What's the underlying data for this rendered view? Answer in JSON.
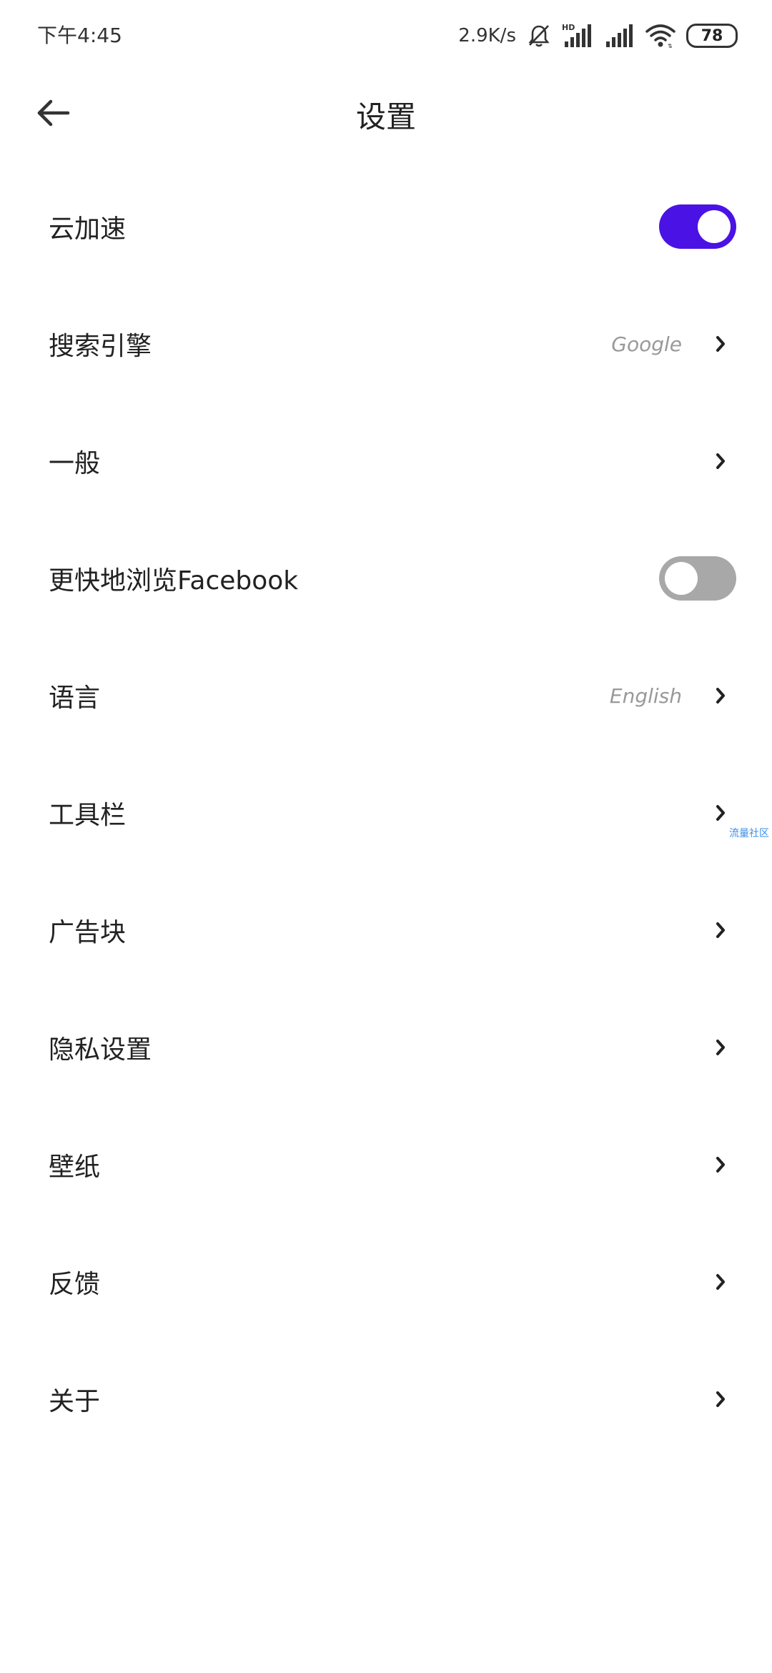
{
  "status_bar": {
    "time": "下午4:45",
    "net_speed": "2.9K/s",
    "battery": "78",
    "icons": [
      "mute-bell-icon",
      "hd-signal-icon",
      "signal-icon",
      "wifi-icon",
      "battery-icon"
    ]
  },
  "app_bar": {
    "title": "设置",
    "back_icon": "arrow-left-icon"
  },
  "settings": [
    {
      "label": "云加速",
      "type": "toggle",
      "on": true
    },
    {
      "label": "搜索引擎",
      "type": "link",
      "value": "Google"
    },
    {
      "label": "一般",
      "type": "link"
    },
    {
      "label": "更快地浏览Facebook",
      "type": "toggle",
      "on": false
    },
    {
      "label": "语言",
      "type": "link",
      "value": "English"
    },
    {
      "label": "工具栏",
      "type": "link"
    },
    {
      "label": "广告块",
      "type": "link"
    },
    {
      "label": "隐私设置",
      "type": "link"
    },
    {
      "label": "壁纸",
      "type": "link"
    },
    {
      "label": "反馈",
      "type": "link"
    },
    {
      "label": "关于",
      "type": "link"
    }
  ],
  "watermark": "流量社区",
  "colors": {
    "toggle_on": "#4a12e4",
    "toggle_off": "#a8a8a8",
    "value_text": "#999999"
  }
}
